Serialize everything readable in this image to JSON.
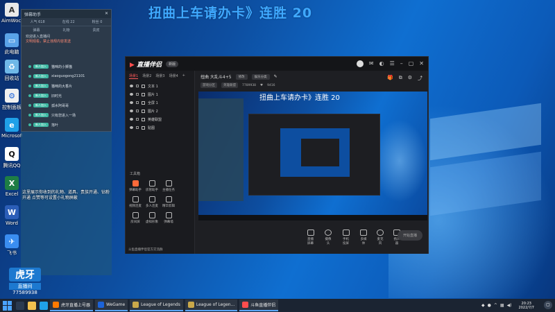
{
  "overlay": {
    "title": "扭曲上车请办卡》连胜 20"
  },
  "desktop": {
    "icons": [
      {
        "label": "AimWoche",
        "icon": "app-icon"
      },
      {
        "label": "此电脑",
        "icon": "computer-icon"
      },
      {
        "label": "回收站",
        "icon": "recycle-bin-icon"
      },
      {
        "label": "控制面板",
        "icon": "control-panel-icon"
      },
      {
        "label": "Microsoft Edge",
        "icon": "edge-icon"
      },
      {
        "label": "腾讯QQ",
        "icon": "qq-icon"
      },
      {
        "label": "Excel",
        "icon": "excel-icon"
      },
      {
        "label": "Word",
        "icon": "word-icon"
      },
      {
        "label": "飞书",
        "icon": "feishu-icon"
      }
    ],
    "gift_note": "这里展示你收到的礼物、道具、贵族开通、钻粉开通\n点赞等可设置小礼物屏蔽",
    "viewer": {
      "logo": "虎牙",
      "name": "直播间",
      "id": "77589938"
    }
  },
  "chat_panel": {
    "title": "弹幕助手",
    "stats": [
      "人气 618",
      "在线 22",
      "粉丝 0"
    ],
    "tabs": [
      "弹幕",
      "礼物",
      "贵宾"
    ],
    "info_line1": "欢迎进入直播间",
    "info_line2": "文明观看，禁止违规内容发送",
    "messages": [
      {
        "badge": "新人加入",
        "text": "猫咪的小狮猫"
      },
      {
        "badge": "新人加入",
        "text": "xiaoguogong21101"
      },
      {
        "badge": "新人加入",
        "text": "猫咪的大香片"
      },
      {
        "badge": "新人加入",
        "text": "旧时光"
      },
      {
        "badge": "新人加入",
        "text": "孤水阿哥哥"
      },
      {
        "badge": "新人加入",
        "text": "只有您进入一场"
      },
      {
        "badge": "新人加入",
        "text": "落叶"
      }
    ]
  },
  "app": {
    "logo_main": "直播伴侣",
    "version": "新版",
    "scene_tabs": [
      "场景1",
      "场景2",
      "场景3",
      "场景4"
    ],
    "sources": [
      "文本 1",
      "图片 1",
      "全屏 1",
      "图片 2",
      "英雄联盟",
      "贴图"
    ],
    "tools_title": "工具箱",
    "tools": [
      {
        "label": "弹幕助手",
        "hot": true
      },
      {
        "label": "房管助手",
        "hot": false
      },
      {
        "label": "主播任务",
        "hot": false
      },
      {
        "label": "",
        "hot": false
      },
      {
        "label": "视频连麦",
        "hot": false
      },
      {
        "label": "多人连麦",
        "hot": false
      },
      {
        "label": "精华剪辑",
        "hot": false
      },
      {
        "label": "",
        "hot": false
      },
      {
        "label": "房间屏",
        "hot": false
      },
      {
        "label": "虚拟形象",
        "hot": false
      },
      {
        "label": "弹幕墙",
        "hot": false
      },
      {
        "label": "",
        "hot": false
      }
    ],
    "side_footer": "斗鱼直播伴侣官方交流群",
    "live": {
      "title": "扭曲 大乱斗4+5",
      "edit": "修改",
      "category_tag": "娱乐分类",
      "category": "游戏分区",
      "room_tag": "英雄联盟",
      "room_id": "7789938",
      "fans": "9416"
    },
    "preview_title": "扭曲上车请办卡》连胜 20",
    "bottom": [
      "直播屏幕",
      "摄像头",
      "手机投屏",
      "多媒体",
      "麦克风",
      "扬声器"
    ],
    "start_button": "开始直播"
  },
  "taskbar": {
    "tasks": [
      {
        "label": "虎牙直播上号器",
        "color": "#ff7a00"
      },
      {
        "label": "WeGame",
        "color": "#1b63d9"
      },
      {
        "label": "League of Legends",
        "color": "#c9a84a"
      },
      {
        "label": "League of Legen...",
        "color": "#c9a84a"
      },
      {
        "label": "斗鱼直播伴侣",
        "color": "#ff4d4d"
      }
    ],
    "time": "20:23",
    "date": "2022/7/7"
  }
}
